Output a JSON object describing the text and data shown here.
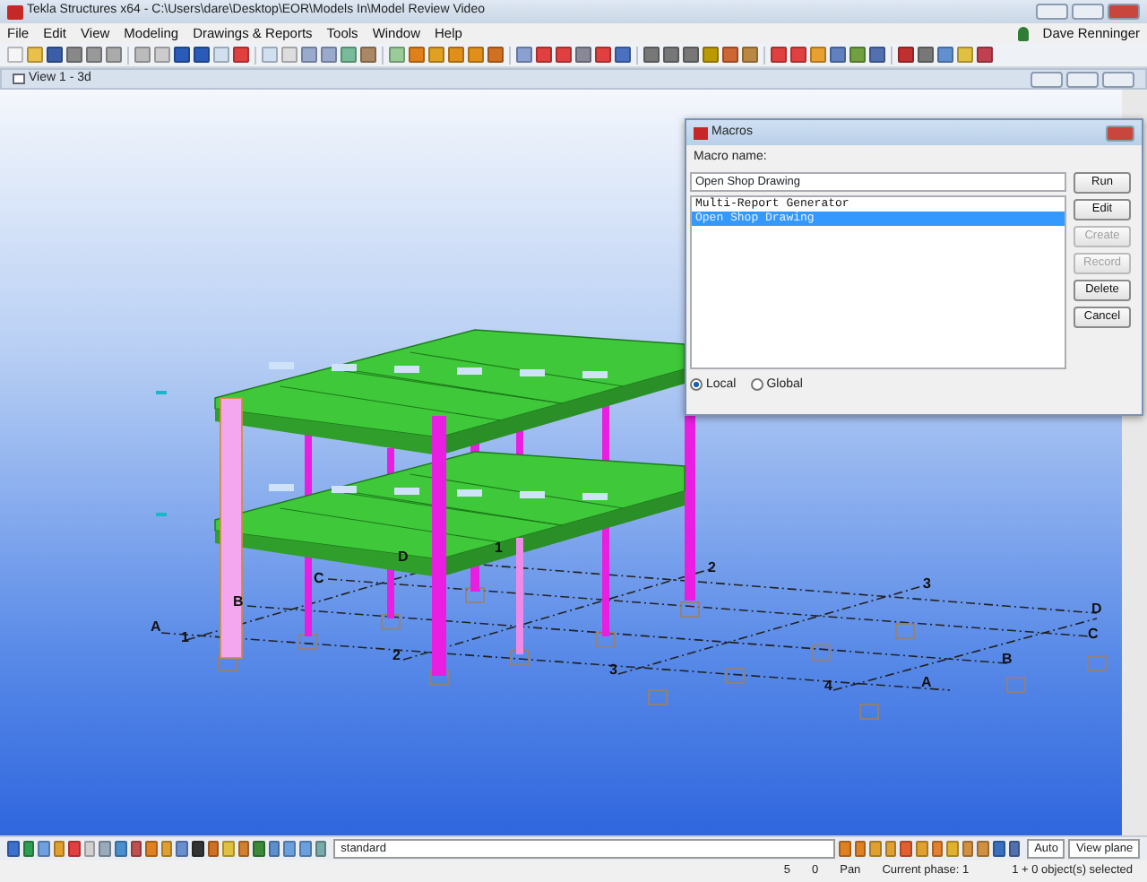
{
  "window": {
    "title": "Tekla Structures x64 - C:\\Users\\dare\\Desktop\\EOR\\Models In\\Model Review Video"
  },
  "menu": [
    "File",
    "Edit",
    "View",
    "Modeling",
    "Drawings & Reports",
    "Tools",
    "Window",
    "Help"
  ],
  "user": "Dave Renninger",
  "view": {
    "title": "View 1 - 3d",
    "grid_labels": [
      "A",
      "1",
      "B",
      "C",
      "D",
      "1",
      "2",
      "3",
      "D",
      "C",
      "B",
      "A",
      "4",
      "3",
      "2"
    ]
  },
  "dialog": {
    "title": "Macros",
    "field_label": "Macro name:",
    "field_value": "Open Shop Drawing",
    "items": [
      {
        "text": "Multi-Report Generator",
        "selected": false
      },
      {
        "text": "Open Shop Drawing",
        "selected": true
      }
    ],
    "buttons": [
      {
        "label": "Run",
        "disabled": false
      },
      {
        "label": "Edit",
        "disabled": false
      },
      {
        "label": "Create",
        "disabled": true
      },
      {
        "label": "Record",
        "disabled": true
      },
      {
        "label": "Delete",
        "disabled": false
      },
      {
        "label": "Cancel",
        "disabled": false
      }
    ],
    "radios": [
      {
        "label": "Local",
        "selected": true
      },
      {
        "label": "Global",
        "selected": false
      }
    ]
  },
  "bottom_toolbar": {
    "filter": "standard",
    "snap": "Auto",
    "plane": "View plane"
  },
  "status_bar": [
    "5",
    "0",
    "Pan",
    "Current phase: 1",
    "1 + 0 object(s) selected"
  ]
}
